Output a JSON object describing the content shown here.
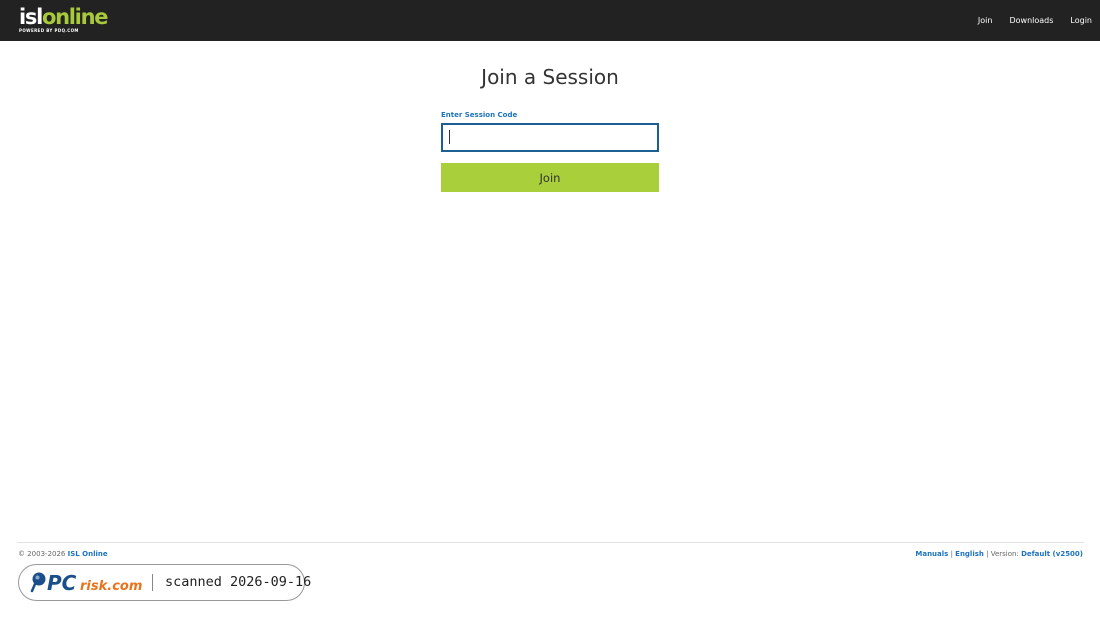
{
  "header": {
    "logo": {
      "part1": "isl",
      "part2": "online",
      "tagline": "POWERED BY PDQ.COM"
    },
    "nav": [
      {
        "label": "Join"
      },
      {
        "label": "Downloads"
      },
      {
        "label": "Login"
      }
    ]
  },
  "main": {
    "title": "Join a Session",
    "session_code": {
      "label": "Enter Session Code",
      "value": "",
      "placeholder": ""
    },
    "join_label": "Join"
  },
  "footer": {
    "copyright": "© 2003-2026",
    "company_link": "ISL Online",
    "manuals_link": "Manuals",
    "sep1": "|",
    "language_link": "English",
    "sep2": "|",
    "version_label": "Version:",
    "version_link": "Default (v2500)"
  },
  "watermark": {
    "brand_pc": "PC",
    "brand_rest": "risk.com",
    "text": "scanned 2026-09-16"
  },
  "colors": {
    "topbar": "#222222",
    "accent_green": "#a9cf3a",
    "link_blue": "#1e73be",
    "input_border": "#1c5f95"
  }
}
